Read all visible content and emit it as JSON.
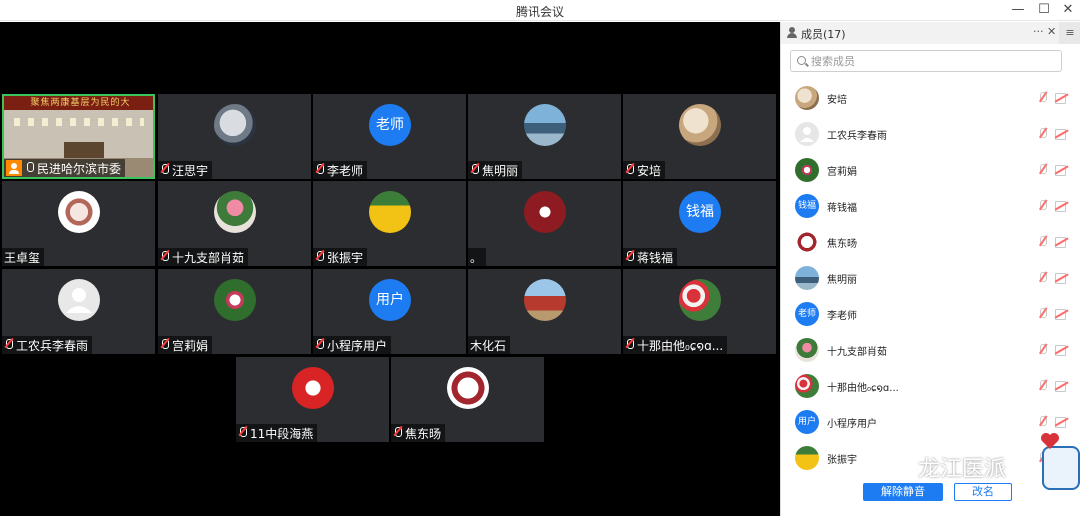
{
  "window": {
    "title": "腾讯会议",
    "controls": [
      "minimize",
      "maximize",
      "close"
    ]
  },
  "video_grid": {
    "tiles": [
      {
        "name": "民进哈尔滨市委",
        "kind": "video",
        "host": true,
        "mic": "on",
        "banner": "聚焦两康基层为民的大"
      },
      {
        "name": "汪思宇",
        "kind": "photo",
        "mic": "muted"
      },
      {
        "name": "李老师",
        "kind": "text-avatar",
        "avatar_text": "老师",
        "mic": "muted"
      },
      {
        "name": "焦明丽",
        "kind": "photo",
        "mic": "muted"
      },
      {
        "name": "安培",
        "kind": "photo",
        "mic": "muted"
      },
      {
        "name": "王卓玺",
        "kind": "photo",
        "mic": "none"
      },
      {
        "name": "十九支部肖茹",
        "kind": "photo",
        "mic": "muted"
      },
      {
        "name": "张振宇",
        "kind": "photo",
        "mic": "muted"
      },
      {
        "name": "。",
        "kind": "photo",
        "mic": "none"
      },
      {
        "name": "蒋钱福",
        "kind": "text-avatar",
        "avatar_text": "钱福",
        "mic": "muted"
      },
      {
        "name": "工农兵李春雨",
        "kind": "default-avatar",
        "mic": "muted"
      },
      {
        "name": "宫莉娟",
        "kind": "photo",
        "mic": "muted"
      },
      {
        "name": "小程序用户",
        "kind": "text-avatar",
        "avatar_text": "用户",
        "mic": "muted"
      },
      {
        "name": "木化石",
        "kind": "photo",
        "mic": "none"
      },
      {
        "name": "十那由他₀ɕ໑ɑ...",
        "kind": "photo",
        "mic": "muted"
      },
      {
        "name": "11中段海燕",
        "kind": "photo",
        "mic": "muted"
      },
      {
        "name": "焦东旸",
        "kind": "photo",
        "mic": "muted"
      }
    ]
  },
  "members_panel": {
    "title": "成员(17)",
    "more_label": "···",
    "close_label": "✕",
    "side_menu_label": "≡",
    "search_placeholder": "搜索成员",
    "members": [
      {
        "name": "安培",
        "avatar": "photo"
      },
      {
        "name": "工农兵李春雨",
        "avatar": "default"
      },
      {
        "name": "宫莉娟",
        "avatar": "photo"
      },
      {
        "name": "蒋钱福",
        "avatar": "text",
        "avatar_text": "钱福"
      },
      {
        "name": "焦东旸",
        "avatar": "photo"
      },
      {
        "name": "焦明丽",
        "avatar": "photo"
      },
      {
        "name": "李老师",
        "avatar": "text",
        "avatar_text": "老师"
      },
      {
        "name": "十九支部肖茹",
        "avatar": "photo"
      },
      {
        "name": "十那由他₀ɕ໑ɑ...",
        "avatar": "photo"
      },
      {
        "name": "小程序用户",
        "avatar": "text",
        "avatar_text": "用户"
      },
      {
        "name": "张振宇",
        "avatar": "photo"
      }
    ],
    "unmute_all_label": "解除静音",
    "rename_label": "改名"
  },
  "watermark": {
    "text": "龙江医派"
  },
  "colors": {
    "stage_bg": "#000000",
    "tile_bg": "#2c2d30",
    "accent_blue": "#1d7cf2",
    "host_orange": "#ff8a00",
    "muted_red": "#ff3b3b"
  }
}
